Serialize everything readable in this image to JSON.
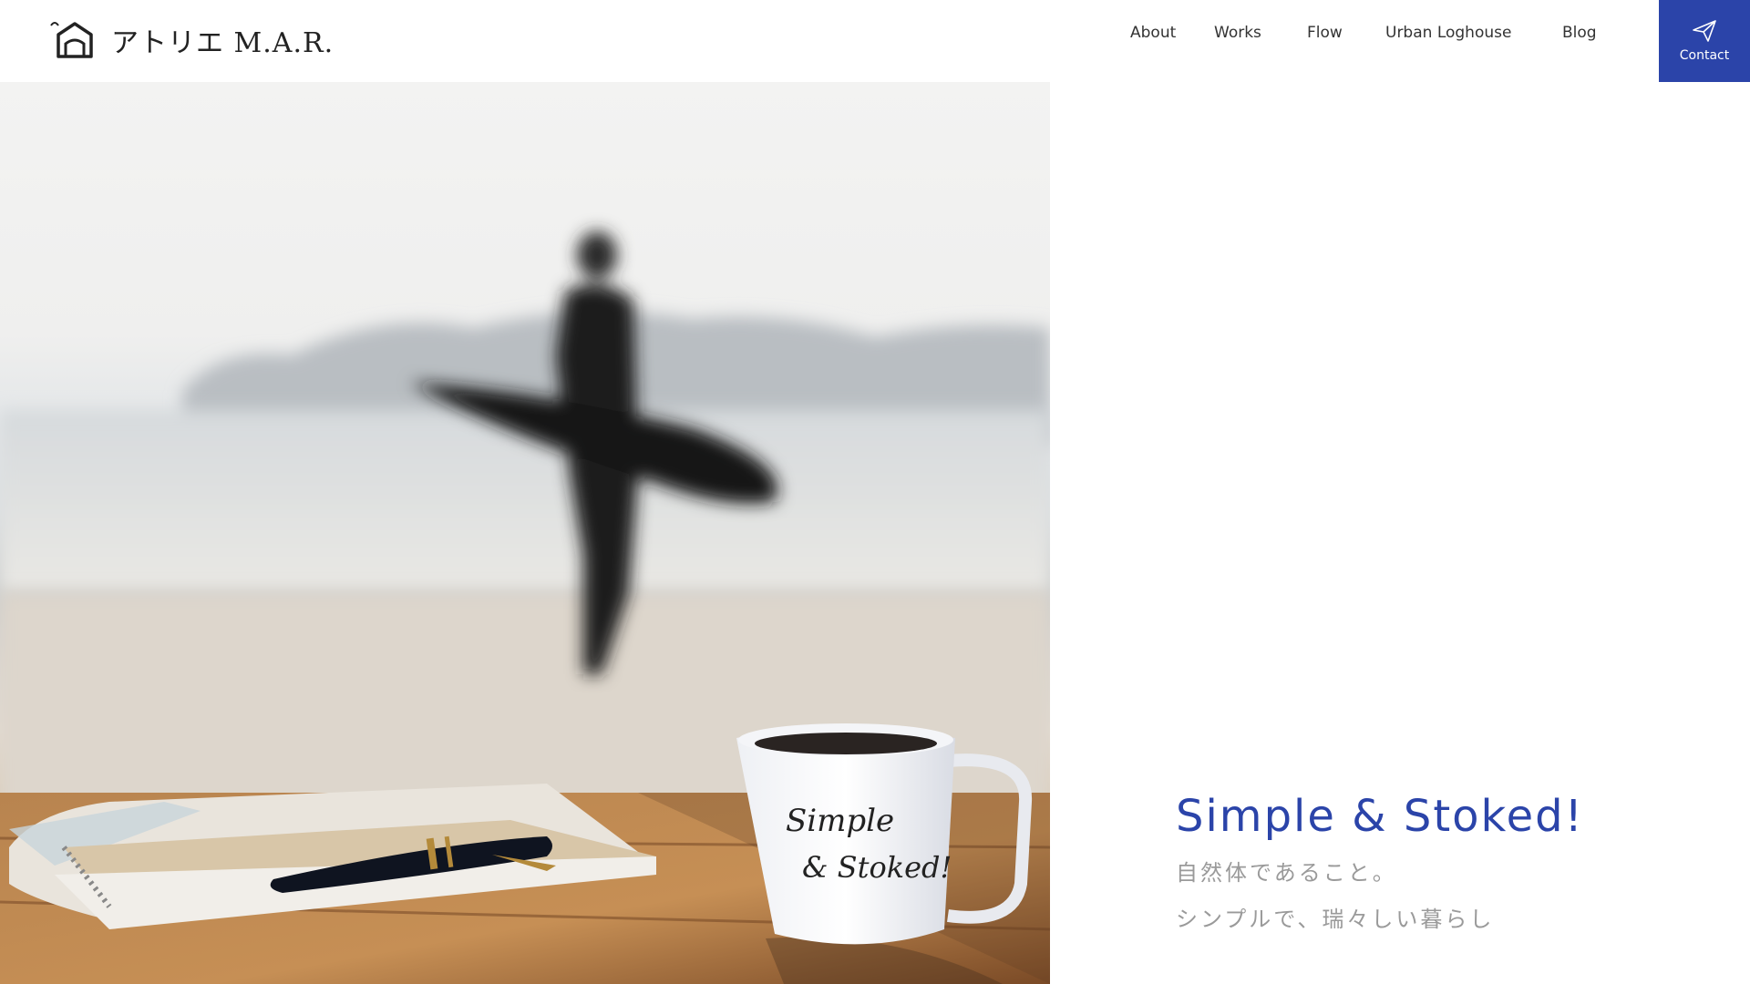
{
  "header": {
    "logo_text": "アトリエ M.A.R.",
    "nav": [
      {
        "label": "About"
      },
      {
        "label": "Works"
      },
      {
        "label": "Flow"
      },
      {
        "label": "Urban Loghouse"
      },
      {
        "label": "Blog"
      }
    ],
    "contact_label": "Contact",
    "contact_icon": "paper-plane-icon"
  },
  "hero": {
    "photo_text_line1": "Simple",
    "photo_text_line2": "& Stoked!"
  },
  "tagline": {
    "title": "Simple & Stoked!",
    "line1": "自然体であること。",
    "line2": "シンプルで、瑞々しい暮らし"
  },
  "colors": {
    "accent": "#2b44a9",
    "subtext": "#9a9a9a"
  }
}
